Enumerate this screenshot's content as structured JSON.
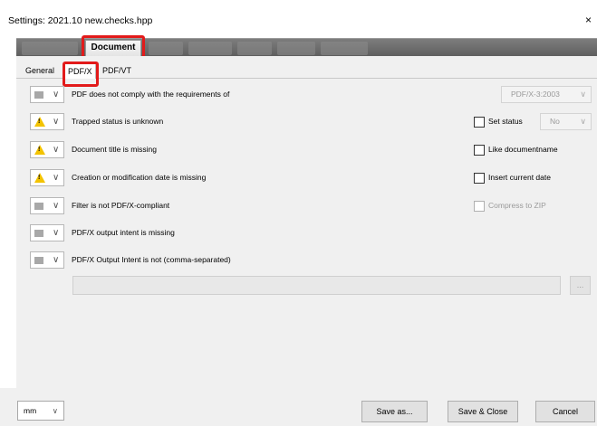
{
  "window": {
    "title_prefix": "Settings:",
    "filename": "2021.10 new.checks.hpp",
    "close_glyph": "×"
  },
  "main_tabs": {
    "active": "Document"
  },
  "sub_tabs": [
    {
      "label": "General",
      "active": false
    },
    {
      "label": "PDF/X",
      "active": true
    },
    {
      "label": "PDF/VT",
      "active": false
    }
  ],
  "rows": [
    {
      "severity": "none",
      "label": "PDF does not comply with the requirements of"
    },
    {
      "severity": "warning",
      "label": "Trapped status is unknown"
    },
    {
      "severity": "warning",
      "label": "Document title is missing"
    },
    {
      "severity": "warning",
      "label": "Creation or modification date is missing"
    },
    {
      "severity": "none",
      "label": "Filter is not PDF/X-compliant"
    },
    {
      "severity": "none",
      "label": "PDF/X output intent is missing"
    },
    {
      "severity": "none",
      "label": "PDF/X Output Intent is not (comma-separated)"
    }
  ],
  "options": {
    "pdfx_version": "PDF/X-3:2003",
    "set_status_label": "Set status",
    "set_status_value": "No",
    "like_docname_label": "Like documentname",
    "insert_date_label": "Insert current date",
    "compress_zip_label": "Compress to ZIP",
    "output_intent_value": "",
    "browse_label": "..."
  },
  "footer": {
    "unit": "mm",
    "save_as": "Save as...",
    "save_close": "Save & Close",
    "cancel": "Cancel"
  },
  "colors": {
    "highlight": "#e21a1a",
    "warning": "#f3c300",
    "panel": "#f0f0f0"
  },
  "icons": {
    "warning": "warning-triangle-icon",
    "none": "gray-square-icon",
    "chevron": "chevron-down-icon"
  }
}
